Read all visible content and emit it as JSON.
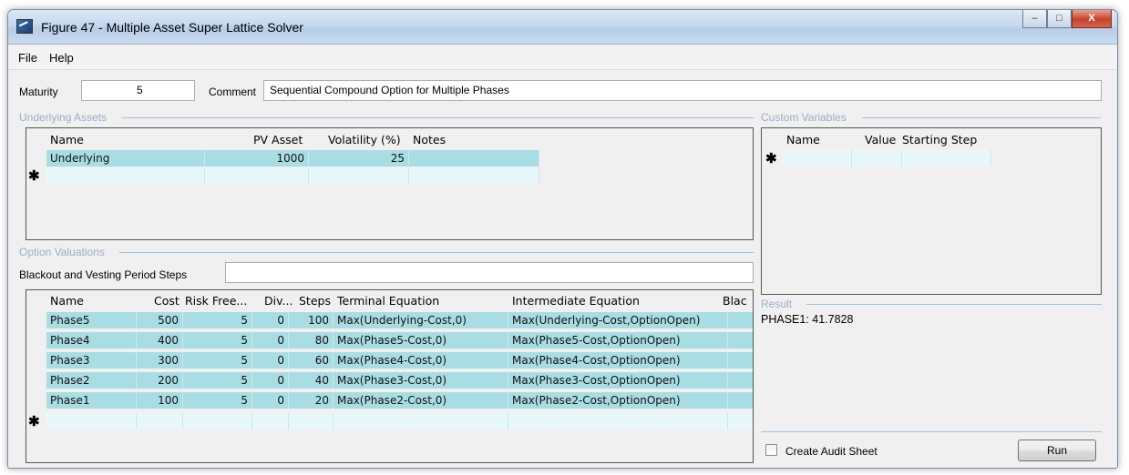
{
  "window": {
    "title": "Figure 47 - Multiple Asset Super Lattice Solver"
  },
  "title_buttons": {
    "minimize": "–",
    "maximize": "□",
    "close": "X"
  },
  "menu": [
    "File",
    "Help"
  ],
  "header": {
    "maturity_label": "Maturity",
    "maturity_value": "5",
    "comment_label": "Comment",
    "comment_value": "Sequential Compound Option for Multiple Phases"
  },
  "underlying": {
    "title": "Underlying Assets",
    "columns": [
      "Name",
      "PV Asset",
      "Volatility (%)",
      "Notes"
    ],
    "rows": [
      [
        "Underlying",
        "1000",
        "25",
        ""
      ]
    ],
    "new_row_marker": "✱"
  },
  "custom": {
    "title": "Custom Variables",
    "columns": [
      "Name",
      "Value",
      "Starting Step"
    ],
    "new_row_marker": "✱"
  },
  "options": {
    "title": "Option Valuations",
    "blackout_label": "Blackout and Vesting Period Steps",
    "blackout_value": "",
    "columns": [
      "Name",
      "Cost",
      "Risk Free...",
      "Div...",
      "Steps",
      "Terminal Equation",
      "Intermediate Equation",
      "Blac"
    ],
    "rows": [
      [
        "Phase5",
        "500",
        "5",
        "0",
        "100",
        "Max(Underlying-Cost,0)",
        "Max(Underlying-Cost,OptionOpen)"
      ],
      [
        "Phase4",
        "400",
        "5",
        "0",
        "80",
        "Max(Phase5-Cost,0)",
        "Max(Phase5-Cost,OptionOpen)"
      ],
      [
        "Phase3",
        "300",
        "5",
        "0",
        "60",
        "Max(Phase4-Cost,0)",
        "Max(Phase4-Cost,OptionOpen)"
      ],
      [
        "Phase2",
        "200",
        "5",
        "0",
        "40",
        "Max(Phase3-Cost,0)",
        "Max(Phase3-Cost,OptionOpen)"
      ],
      [
        "Phase1",
        "100",
        "5",
        "0",
        "20",
        "Max(Phase2-Cost,0)",
        "Max(Phase2-Cost,OptionOpen)"
      ]
    ],
    "new_row_marker": "✱"
  },
  "result": {
    "title": "Result",
    "text": "PHASE1: 41.7828"
  },
  "audit": {
    "label": "Create Audit Sheet",
    "checked": false
  },
  "run_label": "Run",
  "colors": {
    "row_fill": "#a9dde4",
    "empty_row_fill": "#e8f8fa",
    "group_title": "#9aaec8"
  },
  "icons": {
    "app": "app-icon",
    "new_row": "asterisk-icon"
  }
}
